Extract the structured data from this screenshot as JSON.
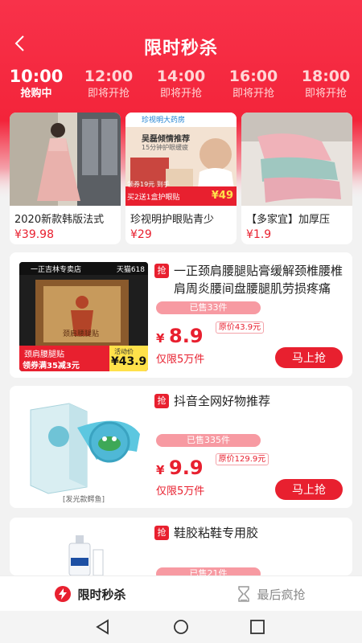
{
  "header": {
    "title": "限时秒杀"
  },
  "time_slots": [
    {
      "time": "10:00",
      "status": "抢购中",
      "active": true
    },
    {
      "time": "12:00",
      "status": "即将开抢",
      "active": false
    },
    {
      "time": "14:00",
      "status": "即将开抢",
      "active": false
    },
    {
      "time": "16:00",
      "status": "即将开抢",
      "active": false
    },
    {
      "time": "18:00",
      "status": "即将开抢",
      "active": false
    }
  ],
  "highlights": [
    {
      "name": "2020新款韩版法式",
      "price": "¥39.98"
    },
    {
      "name": "珍视明护眼贴青少",
      "price": "¥29",
      "img_text": {
        "brand": "珍视明大药房",
        "line1": "吴磊倾情推荐",
        "line2": "15分钟护眼缓疲",
        "promo": "买2送1盒护眼贴",
        "promo2": "领券19元 到手",
        "price": "¥49"
      }
    },
    {
      "name": "【多家宜】加厚压",
      "price": "¥1.9"
    }
  ],
  "products": [
    {
      "tag": "抢",
      "title": "一正颈肩腰腿贴膏缓解颈椎腰椎肩周炎腰间盘腰腿肌劳损疼痛",
      "sold": "已售33件",
      "yen": "¥",
      "price": "8.9",
      "original": "原价43.9元",
      "limit": "仅限5万件",
      "button": "马上抢",
      "img_text": {
        "store": "一正吉林专卖店",
        "mall": "天猫618",
        "box": "颈肩腰腿贴",
        "label": "颈肩腰腿贴",
        "coupon": "领券满35减3元",
        "promo": "活动价",
        "promo_price": "¥43.9"
      }
    },
    {
      "tag": "抢",
      "title": "抖音全网好物推荐",
      "sold": "已售335件",
      "yen": "¥",
      "price": "9.9",
      "original": "原价129.9元",
      "limit": "仅限5万件",
      "button": "马上抢",
      "img_text": {
        "caption": "[发光款鳄鱼]"
      }
    },
    {
      "tag": "抢",
      "title": "鞋胶粘鞋专用胶",
      "sold": "已售21件"
    }
  ],
  "bottom_tabs": [
    {
      "label": "限时秒杀",
      "active": true
    },
    {
      "label": "最后疯抢",
      "active": false
    }
  ],
  "colors": {
    "accent": "#e8202f",
    "hero": "#f3243a"
  },
  "icons": [
    "back-arrow-icon",
    "lightning-icon",
    "hourglass-icon",
    "nav-back-icon",
    "nav-home-icon",
    "nav-recents-icon"
  ]
}
